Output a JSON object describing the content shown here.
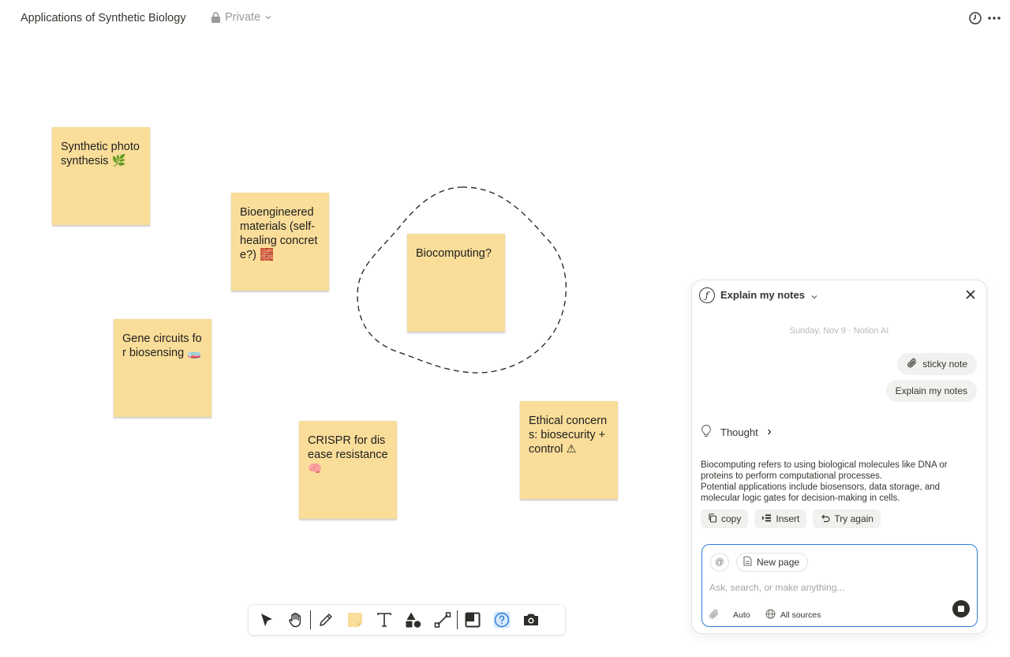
{
  "header": {
    "title": "Applications of Synthetic Biology",
    "privacy_label": "Private",
    "icons": [
      "lock-icon",
      "chevron-down-icon",
      "clock-icon",
      "more-icon"
    ]
  },
  "notes": [
    {
      "id": "synthetic-photosynthesis",
      "text": "Synthetic photosynthesis 🌿"
    },
    {
      "id": "bioengineered-materials",
      "text": "Bioengineered materials (self-healing concrete?) 🧱"
    },
    {
      "id": "biocomputing",
      "text": "Biocomputing?"
    },
    {
      "id": "gene-circuits",
      "text": "Gene circuits for biosensing 🧫"
    },
    {
      "id": "crispr",
      "text": "CRISPR for disease resistance 🧠"
    },
    {
      "id": "ethical-concerns",
      "text": "Ethical concerns: biosecurity + control ⚠"
    }
  ],
  "colors": {
    "sticky": "#f9dd99",
    "accent": "#2d7fd8",
    "text": "#37352f",
    "muted": "#9b9a97"
  },
  "toolbar": {
    "tools": [
      "select",
      "pan",
      "pen",
      "sticky-note",
      "text",
      "shapes",
      "connector",
      "frame",
      "help",
      "camera"
    ],
    "active": "help"
  },
  "ai_panel": {
    "title": "Explain my notes",
    "date": "Sunday, Nov 9 · Notion AI",
    "context_chip": "sticky note",
    "user_message": "Explain my notes",
    "thought_label": "Thought",
    "answer_line1": "Biocomputing refers to using biological molecules like DNA or proteins to perform computational processes.",
    "answer_line2": "Potential applications include biosensors, data storage, and molecular logic gates for decision-making in cells.",
    "actions": {
      "copy": "copy",
      "insert": "Insert",
      "retry": "Try again"
    },
    "composer": {
      "mention": "@",
      "new_page": "New page",
      "placeholder": "Ask, search, or make anything...",
      "mode": "Auto",
      "sources": "All sources"
    }
  }
}
